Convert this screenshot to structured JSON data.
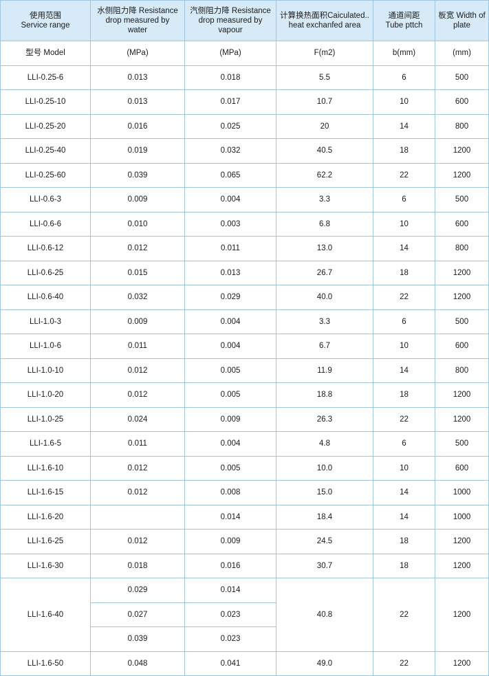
{
  "table": {
    "headers": [
      {
        "line1": "使用范围",
        "line2": "Service range"
      },
      {
        "line1": "水侧阻力降 Resistance",
        "line2": "drop measured by",
        "line3": "water"
      },
      {
        "line1": "汽侧阻力降 Resistance",
        "line2": "drop measured by",
        "line3": "vapour"
      },
      {
        "line1": "计算换热面积Caiculated..",
        "line2": "heat exchanfed area"
      },
      {
        "line1": "通道间距",
        "line2": "Tube pttch"
      },
      {
        "line1": "板宽 Width of",
        "line2": "plate"
      }
    ],
    "units_row": [
      "型号 Model",
      "(MPa)",
      "(MPa)",
      "F(m2)",
      "b(mm)",
      "(mm)"
    ],
    "rows": [
      [
        "LLI-0.25-6",
        "0.013",
        "0.018",
        "5.5",
        "6",
        "500"
      ],
      [
        "LLI-0.25-10",
        "0.013",
        "0.017",
        "10.7",
        "10",
        "600"
      ],
      [
        "LLI-0.25-20",
        "0.016",
        "0.025",
        "20",
        "14",
        "800"
      ],
      [
        "LLI-0.25-40",
        "0.019",
        "0.032",
        "40.5",
        "18",
        "1200"
      ],
      [
        "LLI-0.25-60",
        "0.039",
        "0.065",
        "62.2",
        "22",
        "1200"
      ],
      [
        "LLI-0.6-3",
        "0.009",
        "0.004",
        "3.3",
        "6",
        "500"
      ],
      [
        "LLI-0.6-6",
        "0.010",
        "0.003",
        "6.8",
        "10",
        "600"
      ],
      [
        "LLI-0.6-12",
        "0.012",
        "0.011",
        "13.0",
        "14",
        "800"
      ],
      [
        "LLI-0.6-25",
        "0.015",
        "0.013",
        "26.7",
        "18",
        "1200"
      ],
      [
        "LLI-0.6-40",
        "0.032",
        "0.029",
        "40.0",
        "22",
        "1200"
      ],
      [
        "LLI-1.0-3",
        "0.009",
        "0.004",
        "3.3",
        "6",
        "500"
      ],
      [
        "LLI-1.0-6",
        "0.011",
        "0.004",
        "6.7",
        "10",
        "600"
      ],
      [
        "LLI-1.0-10",
        "0.012",
        "0.005",
        "11.9",
        "14",
        "800"
      ],
      [
        "LLI-1.0-20",
        "0.012",
        "0.005",
        "18.8",
        "18",
        "1200"
      ],
      [
        "LLI-1.0-25",
        "0.024",
        "0.009",
        "26.3",
        "22",
        "1200"
      ],
      [
        "LLI-1.6-5",
        "0.011",
        "0.004",
        "4.8",
        "6",
        "500"
      ],
      [
        "LLI-1.6-10",
        "0.012",
        "0.005",
        "10.0",
        "10",
        "600"
      ],
      [
        "LLI-1.6-15",
        "0.012",
        "0.008",
        "15.0",
        "14",
        "1000"
      ],
      [
        "LLI-1.6-20",
        "",
        "0.014",
        "18.4",
        "14",
        "1000"
      ],
      [
        "LLI-1.6-25",
        "0.012",
        "0.009",
        "24.5",
        "18",
        "1200"
      ],
      [
        "LLI-1.6-30",
        "0.018",
        "0.016",
        "30.7",
        "18",
        "1200"
      ],
      [
        "",
        "0.029",
        "0.014",
        "",
        "",
        ""
      ],
      [
        "LLI-1.6-40",
        "0.027",
        "0.023",
        "40.8",
        "22",
        "1200"
      ],
      [
        "",
        "0.039",
        "0.023",
        "",
        "",
        ""
      ],
      [
        "LLI-1.6-50",
        "0.048",
        "0.041",
        "49.0",
        "22",
        "1200"
      ]
    ]
  },
  "colors": {
    "header_bg": "#d6eaf7",
    "border": "#9fc5e0",
    "text": "#1a1a1a"
  }
}
